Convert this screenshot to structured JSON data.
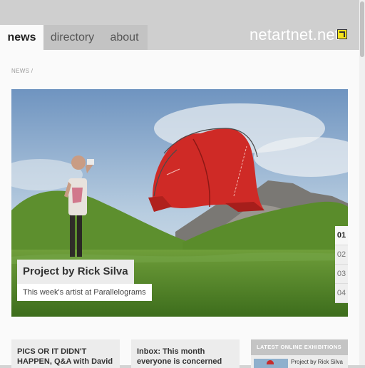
{
  "nav": {
    "tabs": [
      {
        "label": "news",
        "active": true
      },
      {
        "label": "directory",
        "active": false
      },
      {
        "label": "about",
        "active": false
      }
    ],
    "logo": "netartnet.net",
    "logo_icon": "external-link-icon"
  },
  "breadcrumb": "NEWS /",
  "hero": {
    "title": "Project by Rick Silva",
    "subtitle": "This week's artist at Parallelograms",
    "pager": [
      "01",
      "02",
      "03",
      "04"
    ],
    "active_page": "01"
  },
  "cards": [
    {
      "text": "PICS OR IT DIDN'T HAPPEN, Q&A with David Hanes"
    },
    {
      "text": "Inbox: This month everyone is concerned about Post Internet"
    }
  ],
  "sidebar": {
    "heading": "LATEST ONLINE EXHIBITIONS",
    "item": "Project by Rick Silva"
  },
  "colors": {
    "topbar": "#cfcfcf",
    "active_tab": "#fafafa",
    "inactive_tab": "#c3c3c3",
    "logo_accent": "#f5e21b",
    "tent_red": "#cf2a26"
  }
}
